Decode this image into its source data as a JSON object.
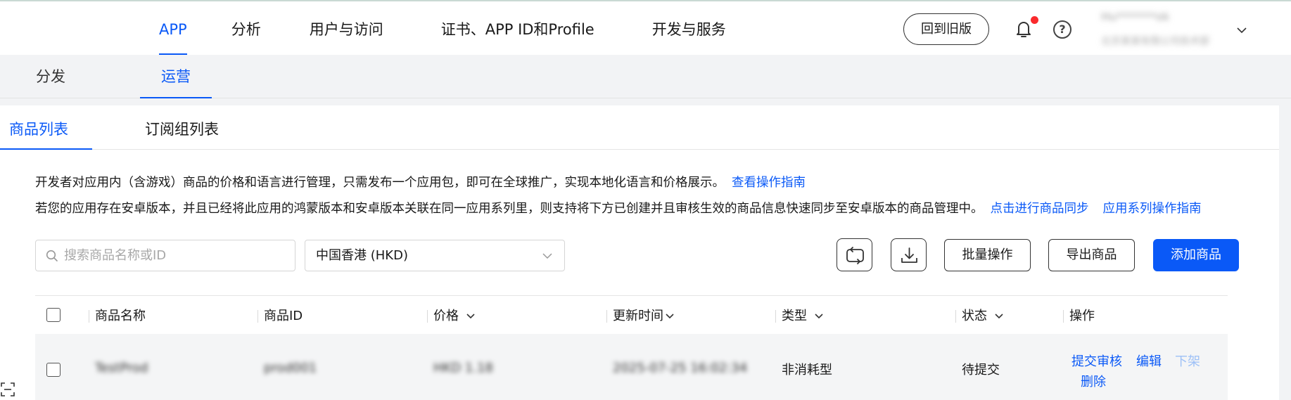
{
  "top_nav": {
    "items": [
      {
        "label": "APP",
        "active": true
      },
      {
        "label": "分析",
        "active": false
      },
      {
        "label": "用户与访问",
        "active": false
      },
      {
        "label": "证书、APP ID和Profile",
        "active": false
      },
      {
        "label": "开发与服务",
        "active": false
      }
    ],
    "old_version_button": "回到旧版",
    "help_glyph": "?",
    "account": {
      "name": "Hu*******ok",
      "org": "北京某某有限公司技术部"
    }
  },
  "sub_nav": {
    "items": [
      {
        "label": "分发",
        "active": false
      },
      {
        "label": "运营",
        "active": true
      }
    ]
  },
  "tabs": [
    {
      "label": "商品列表",
      "active": true
    },
    {
      "label": "订阅组列表",
      "active": false
    }
  ],
  "description": {
    "line1_text": "开发者对应用内（含游戏）商品的价格和语言进行管理，只需发布一个应用包，即可在全球推广，实现本地化语言和价格展示。",
    "line1_link": "查看操作指南",
    "line2_text": "若您的应用存在安卓版本，并且已经将此应用的鸿蒙版本和安卓版本关联在同一应用系列里，则支持将下方已创建并且审核生效的商品信息快速同步至安卓版本的商品管理中。",
    "line2_link1": "点击进行商品同步",
    "line2_link2": "应用系列操作指南"
  },
  "filters": {
    "search_placeholder": "搜索商品名称或ID",
    "region_value": "中国香港 (HKD)"
  },
  "actions": {
    "batch": "批量操作",
    "export": "导出商品",
    "add": "添加商品"
  },
  "table": {
    "headers": {
      "name": "商品名称",
      "id": "商品ID",
      "price": "价格",
      "updated": "更新时间",
      "type": "类型",
      "status": "状态",
      "ops": "操作"
    },
    "rows": [
      {
        "name": "TestProd",
        "id": "prod001",
        "price": "HKD 1.18",
        "updated": "2025-07-25 16:02:34",
        "type": "非消耗型",
        "status": "待提交",
        "ops": [
          "提交审核",
          "编辑",
          "下架",
          "删除"
        ]
      }
    ]
  },
  "colors": {
    "accent": "#0a59f7",
    "alert_dot": "#fa2a2d",
    "subnav_bg": "#f2f3f5"
  },
  "icons": [
    "bell-icon",
    "help-icon",
    "chevron-down-icon",
    "search-icon",
    "sync-icon",
    "download-icon",
    "sort-chevron-icon",
    "scan-icon"
  ]
}
